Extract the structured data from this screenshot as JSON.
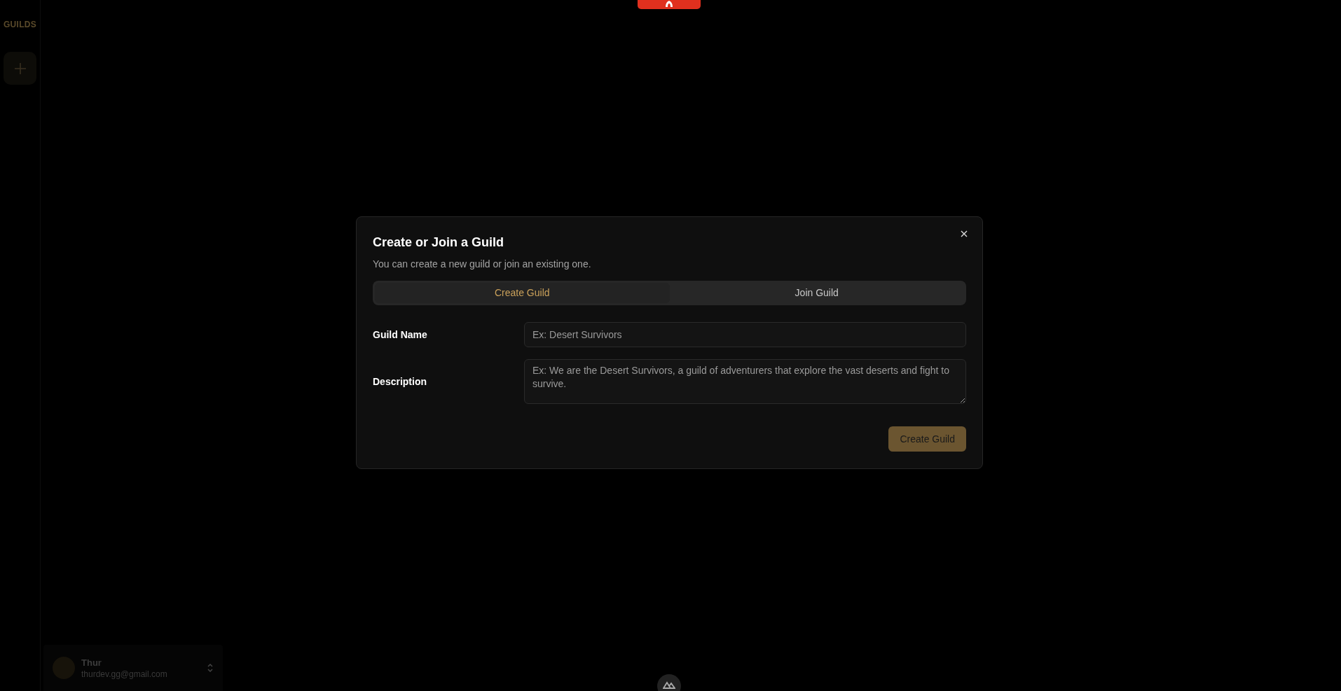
{
  "sidebar": {
    "heading": "GUILDS"
  },
  "user": {
    "name": "Thur",
    "email": "thurdev.gg@gmail.com"
  },
  "dialog": {
    "title": "Create or Join a Guild",
    "description": "You can create a new guild or join an existing one.",
    "tabs": [
      {
        "label": "Create Guild",
        "selected": true
      },
      {
        "label": "Join Guild",
        "selected": false
      }
    ],
    "fields": [
      {
        "kind": "input",
        "label": "Guild Name",
        "placeholder": "Ex: Desert Survivors"
      },
      {
        "kind": "textarea",
        "label": "Description",
        "placeholder": "Ex: We are the Desert Survivors, a guild of adventurers that explore the vast deserts and fight to survive."
      }
    ],
    "submit": "Create Guild"
  }
}
